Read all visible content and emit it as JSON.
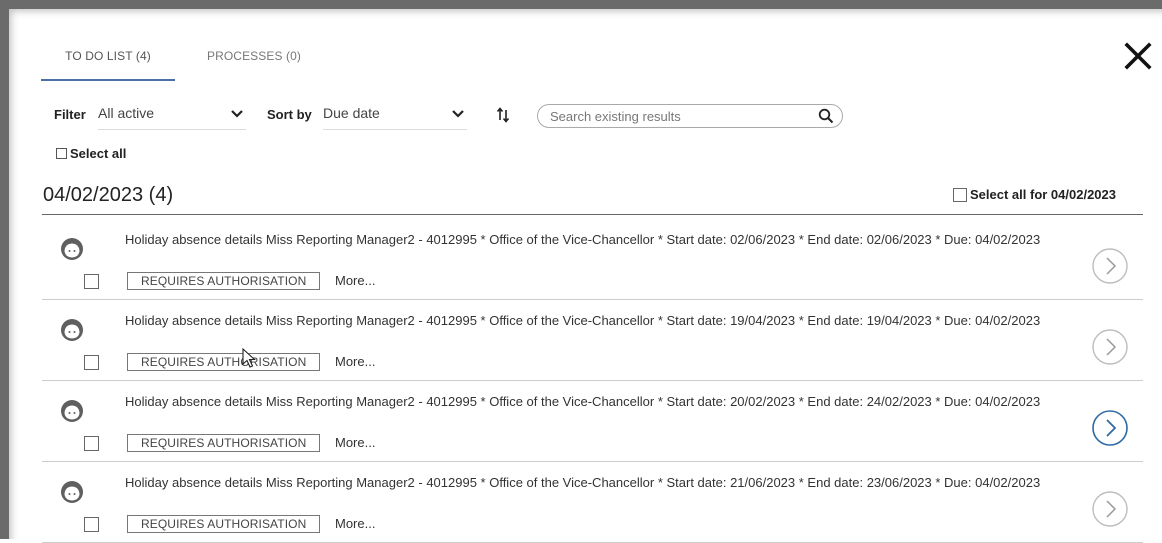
{
  "tabs": [
    {
      "label": "TO DO LIST (4)",
      "active": true
    },
    {
      "label": "PROCESSES (0)",
      "active": false
    }
  ],
  "toolbar": {
    "filter_label": "Filter",
    "filter_value": "All active",
    "sort_label": "Sort by",
    "sort_value": "Due date",
    "search_placeholder": "Search existing results"
  },
  "select_all_label": "Select all",
  "group": {
    "title": "04/02/2023 (4)",
    "select_all_label": "Select all for 04/02/2023"
  },
  "rows": [
    {
      "description": "Holiday absence details Miss Reporting Manager2 - 4012995 * Office of the Vice-Chancellor * Start date: 02/06/2023 * End date: 02/06/2023 * Due: 04/02/2023",
      "status": "REQUIRES AUTHORISATION",
      "more": "More...",
      "open_active": false
    },
    {
      "description": "Holiday absence details Miss Reporting Manager2 - 4012995 * Office of the Vice-Chancellor * Start date: 19/04/2023 * End date: 19/04/2023 * Due: 04/02/2023",
      "status": "REQUIRES AUTHORISATION",
      "more": "More...",
      "open_active": false
    },
    {
      "description": "Holiday absence details Miss Reporting Manager2 - 4012995 * Office of the Vice-Chancellor * Start date: 20/02/2023 * End date: 24/02/2023 * Due: 04/02/2023",
      "status": "REQUIRES AUTHORISATION",
      "more": "More...",
      "open_active": true
    },
    {
      "description": "Holiday absence details Miss Reporting Manager2 - 4012995 * Office of the Vice-Chancellor * Start date: 21/06/2023 * End date: 23/06/2023 * Due: 04/02/2023",
      "status": "REQUIRES AUTHORISATION",
      "more": "More...",
      "open_active": false
    }
  ],
  "colors": {
    "accent": "#2f6aa3",
    "tab_underline": "#4a6fa5",
    "inactive_circle": "#bdbdbd"
  }
}
